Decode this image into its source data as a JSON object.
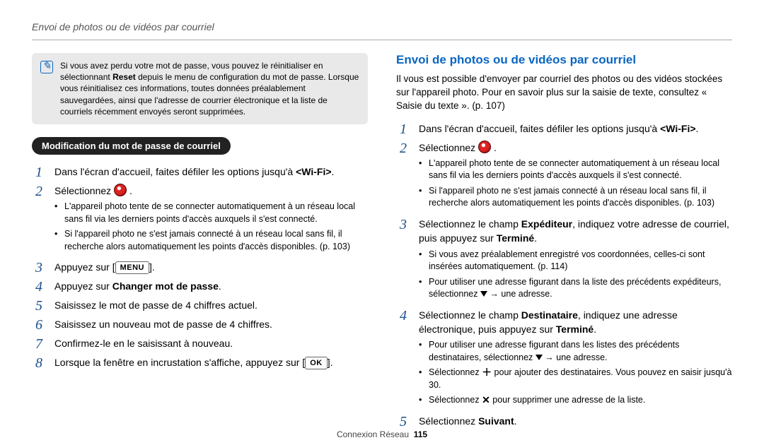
{
  "page_title": "Envoi de photos ou de vidéos par courriel",
  "note": {
    "icon_label": "note-icon",
    "text_html": "Si vous avez perdu votre mot de passe, vous pouvez le réinitialiser en sélectionnant <b>Reset</b> depuis le menu de configuration du mot de passe. Lorsque vous réinitialisez ces informations, toutes données préalablement sauvegardées, ainsi que l'adresse de courrier électronique et la liste de courriels récemment envoyés seront supprimées."
  },
  "left": {
    "pill": "Modification du mot de passe de courriel",
    "steps": [
      {
        "n": "1",
        "html": "Dans l'écran d'accueil, faites défiler les options jusqu'à <b>&lt;Wi-Fi&gt;</b>."
      },
      {
        "n": "2",
        "html": "Sélectionnez <span class='icon-app' data-name='app-icon' data-interactable='false'></span> .",
        "bullets": [
          "L'appareil photo tente de se connecter automatiquement à un réseau local sans fil via les derniers points d'accès auxquels il s'est connecté.",
          "Si l'appareil photo ne s'est jamais connecté à un réseau local sans fil, il recherche alors automatiquement les points d'accès disponibles. (p. 103)"
        ]
      },
      {
        "n": "3",
        "html": "Appuyez sur [<span class='btn-img' data-name='menu-button-icon' data-interactable='false'>MENU</span>]."
      },
      {
        "n": "4",
        "html": "Appuyez sur <b>Changer mot de passe</b>."
      },
      {
        "n": "5",
        "html": "Saisissez le mot de passe de 4 chiffres actuel."
      },
      {
        "n": "6",
        "html": "Saisissez un nouveau mot de passe de 4 chiffres."
      },
      {
        "n": "7",
        "html": "Confirmez-le en le saisissant à nouveau."
      },
      {
        "n": "8",
        "html": "Lorsque la fenêtre en incrustation s'affiche, appuyez sur [<span class='btn-img' data-name='ok-button-icon' data-interactable='false'>OK</span>]."
      }
    ]
  },
  "right": {
    "heading": "Envoi de photos ou de vidéos par courriel",
    "intro": "Il vous est possible d'envoyer par courriel des photos ou des vidéos stockées sur l'appareil photo. Pour en savoir plus sur la saisie de texte, consultez « Saisie du texte ». (p. 107)",
    "steps": [
      {
        "n": "1",
        "html": "Dans l'écran d'accueil, faites défiler les options jusqu'à <b>&lt;Wi-Fi&gt;</b>."
      },
      {
        "n": "2",
        "html": "Sélectionnez <span class='icon-app' data-name='app-icon' data-interactable='false'></span> .",
        "bullets": [
          "L'appareil photo tente de se connecter automatiquement à un réseau local sans fil via les derniers points d'accès auxquels il s'est connecté.",
          "Si l'appareil photo ne s'est jamais connecté à un réseau local sans fil, il recherche alors automatiquement les points d'accès disponibles. (p. 103)"
        ]
      },
      {
        "n": "3",
        "html": "Sélectionnez le champ <b>Expéditeur</b>, indiquez votre adresse de courriel, puis appuyez sur <b>Terminé</b>.",
        "bullets": [
          "Si vous avez préalablement enregistré vos coordonnées, celles-ci sont insérées automatiquement. (p. 114)",
          "Pour utiliser une adresse figurant dans la liste des précédents expéditeurs, sélectionnez <span class='icon-down' data-name='chevron-down-icon' data-interactable='false'></span> <span class='arrow'>→</span> une adresse."
        ]
      },
      {
        "n": "4",
        "html": "Sélectionnez le champ <b>Destinataire</b>, indiquez une adresse électronique, puis appuyez sur <b>Terminé</b>.",
        "bullets": [
          "Pour utiliser une adresse figurant dans les listes des précédents destinataires, sélectionnez <span class='icon-down' data-name='chevron-down-icon' data-interactable='false'></span> <span class='arrow'>→</span> une adresse.",
          "Sélectionnez <span class='icon-plus' data-name='plus-icon' data-interactable='false'>＋</span> pour ajouter des destinataires. Vous pouvez en saisir jusqu'à 30.",
          "Sélectionnez <span class='icon-x' data-name='close-icon' data-interactable='false'>✕</span> pour supprimer une adresse de la liste."
        ]
      },
      {
        "n": "5",
        "html": "Sélectionnez <b>Suivant</b>."
      }
    ]
  },
  "footer": {
    "section": "Connexion Réseau",
    "page": "115"
  }
}
